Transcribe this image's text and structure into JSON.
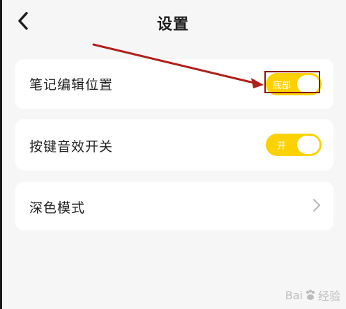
{
  "header": {
    "title": "设置",
    "back_icon": "chevron-left-icon"
  },
  "settings": {
    "note_edit_position": {
      "label": "笔记编辑位置",
      "toggle_text": "底部",
      "enabled": true
    },
    "key_sound": {
      "label": "按键音效开关",
      "toggle_text": "开",
      "enabled": true
    },
    "dark_mode": {
      "label": "深色模式",
      "chevron_icon": "chevron-right-icon"
    }
  },
  "colors": {
    "accent": "#fbd200",
    "annotation": "#b0201a",
    "background": "#f6f6f6",
    "card": "#ffffff"
  },
  "watermark": {
    "left": "Bai",
    "right": "经验"
  }
}
